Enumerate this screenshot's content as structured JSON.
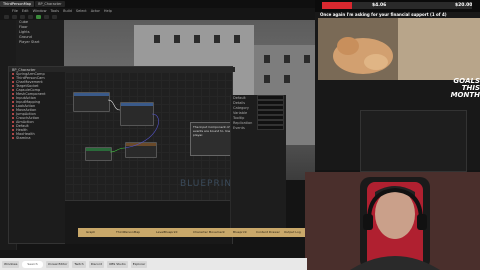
{
  "editor": {
    "tabs": [
      "ThirdPersonMap",
      "BP_Character"
    ],
    "menu": [
      "File",
      "Edit",
      "Window",
      "Tools",
      "Build",
      "Select",
      "Actor",
      "Help"
    ]
  },
  "outliner": {
    "items": [
      "Cube",
      "Floor",
      "Lights",
      "Ground",
      "Player Start"
    ]
  },
  "blueprint": {
    "title": "BP_Character",
    "variables": [
      "SpringArmComp",
      "ThirdPersonCam",
      "CharMovement",
      "TargetSocket",
      "CapsuleComp",
      "MeshComponent",
      "InputAction",
      "InputMapping",
      "LookAction",
      "MoveAction",
      "JumpAction",
      "CrouchAction",
      "AimAction",
      "Default",
      "Health",
      "MaxHealth",
      "Stamina"
    ],
    "watermark": "BLUEPRINT",
    "tooltip": "The Input Component of the Actor that the Input Action events are bound to. Use to receive input from the player.",
    "details_labels": [
      "Default",
      "Details",
      "Category",
      "Variable",
      "Tooltip",
      "Replication",
      "Events"
    ],
    "gold_labels": [
      "Graph",
      "ThirdPersonMap",
      "LevelBlueprint",
      "Character Movement",
      "Blueprint",
      "Content Drawer",
      "Output Log"
    ]
  },
  "stream": {
    "goal_left": "$4.06",
    "goal_right": "$20.00",
    "goal_progress": 0.2,
    "support_text": "Once again I'm asking for your financial support (1 of 4)",
    "goals_line1": "GOALS",
    "goals_line2": "THIS MONTH"
  },
  "taskbar": {
    "search": "Search",
    "items": [
      "Windows",
      "Unreal Editor",
      "Twitch",
      "Discord",
      "OBS Studio",
      "Explorer"
    ]
  },
  "colors": {
    "accent_red": "#d9282f",
    "node_header": "#3a5a8a",
    "gold": "#c9a86a"
  }
}
